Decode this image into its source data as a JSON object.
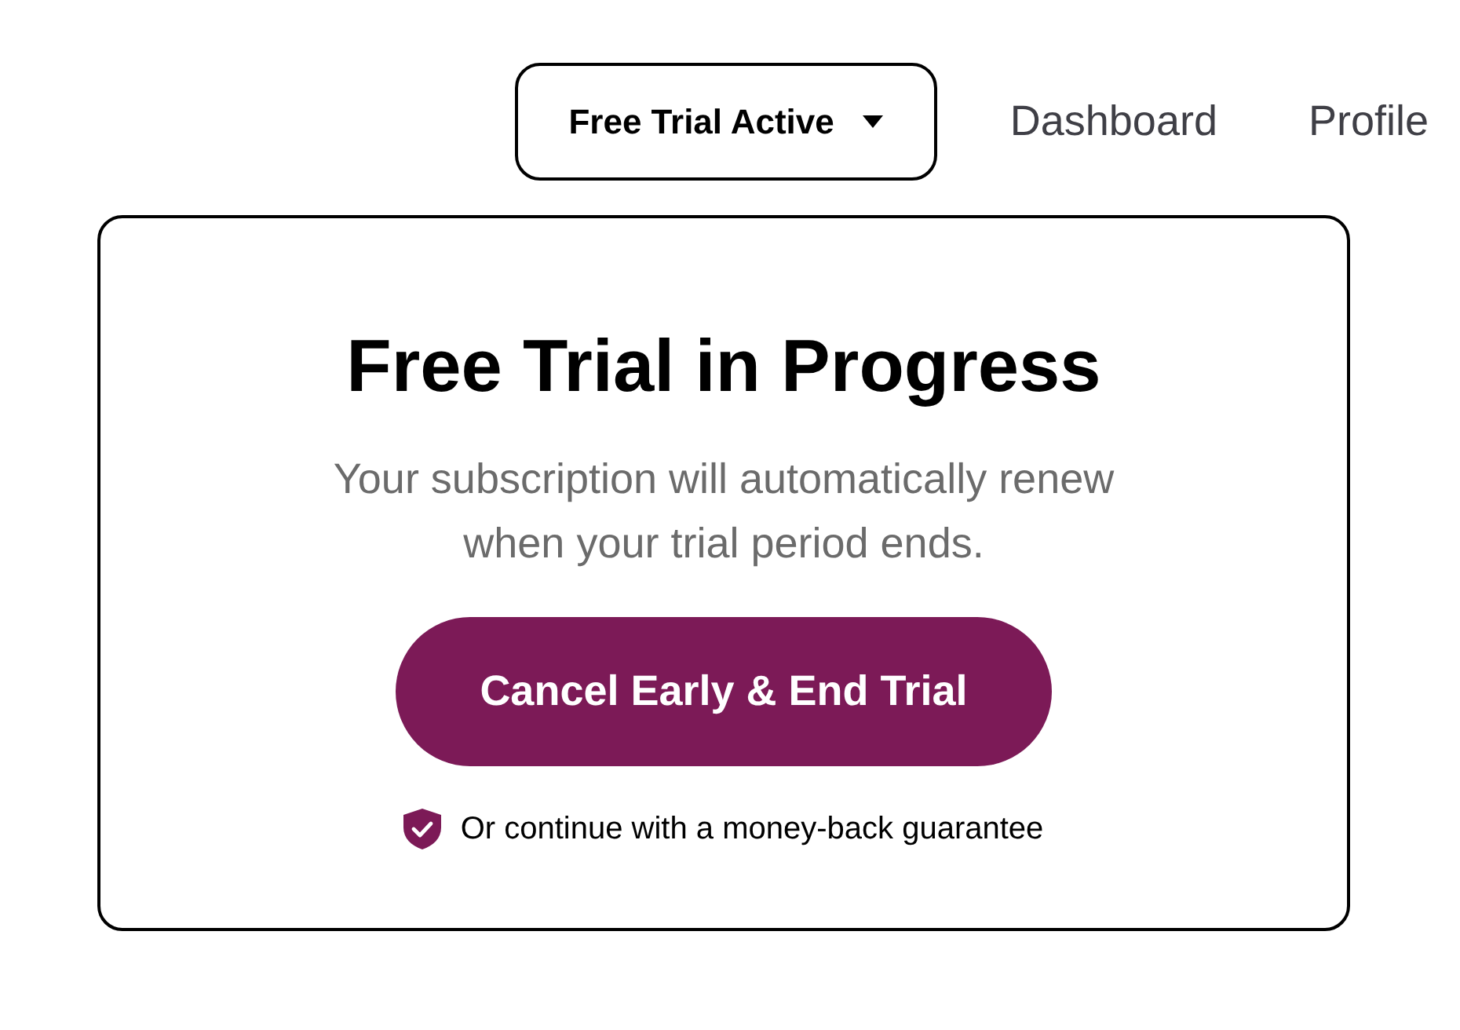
{
  "nav": {
    "plan_menu": {
      "label": "Free Trial Active",
      "expanded": false
    },
    "links": [
      {
        "label": "Dashboard"
      },
      {
        "label": "Profile"
      }
    ]
  },
  "card": {
    "title": "Free Trial in Progress",
    "description": "Your subscription will automatically renew when your trial period ends.",
    "cancel_button": "Cancel Early & End Trial",
    "guarantee": "Or continue with a money-back guarantee"
  }
}
